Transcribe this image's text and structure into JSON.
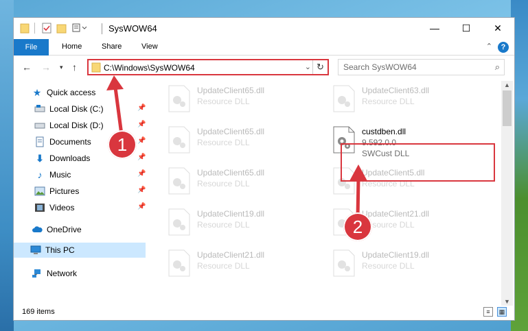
{
  "window": {
    "title": "SysWOW64",
    "minimize": "—",
    "maximize": "☐",
    "close": "✕"
  },
  "ribbon": {
    "tabs": [
      "File",
      "Home",
      "Share",
      "View"
    ],
    "help": "?"
  },
  "address_bar": {
    "path": "C:\\Windows\\SysWOW64",
    "search_placeholder": "Search SysWOW64"
  },
  "nav_pane": {
    "items": [
      {
        "label": "Quick access",
        "icon": "star-icon",
        "pinned": false
      },
      {
        "label": "Local Disk (C:)",
        "icon": "drive-icon",
        "pinned": true
      },
      {
        "label": "Local Disk (D:)",
        "icon": "drive-icon",
        "pinned": true
      },
      {
        "label": "Documents",
        "icon": "documents-icon",
        "pinned": true
      },
      {
        "label": "Downloads",
        "icon": "download-icon",
        "pinned": true
      },
      {
        "label": "Music",
        "icon": "music-icon",
        "pinned": true
      },
      {
        "label": "Pictures",
        "icon": "pictures-icon",
        "pinned": true
      },
      {
        "label": "Videos",
        "icon": "videos-icon",
        "pinned": true
      },
      {
        "label": "OneDrive",
        "icon": "cloud-icon",
        "pinned": false
      },
      {
        "label": "This PC",
        "icon": "computer-icon",
        "pinned": false,
        "selected": true
      },
      {
        "label": "Network",
        "icon": "network-icon",
        "pinned": false
      }
    ]
  },
  "files": {
    "left": [
      {
        "name": "UpdateClient65.dll",
        "type": "Resource DLL"
      },
      {
        "name": "UpdateClient65.dll",
        "type": "Resource DLL"
      },
      {
        "name": "UpdateClient65.dll",
        "type": "Resource DLL"
      },
      {
        "name": "UpdateClient19.dll",
        "type": "Resource DLL"
      },
      {
        "name": "UpdateClient21.dll",
        "type": "Resource DLL"
      }
    ],
    "right": [
      {
        "name": "UpdateClient63.dll",
        "type": "Resource DLL"
      },
      {
        "name": "custdben.dll",
        "version": "9.592.0.0",
        "type": "SWCust DLL",
        "highlighted": true
      },
      {
        "name": "UpdateClient5.dll",
        "type": "Resource DLL"
      },
      {
        "name": "UpdateClient21.dll",
        "type": "Resource DLL"
      },
      {
        "name": "UpdateClient19.dll",
        "type": "Resource DLL"
      }
    ]
  },
  "status": {
    "item_count": "169 items"
  },
  "annotations": {
    "step1": "1",
    "step2": "2",
    "color": "#d9363e"
  }
}
